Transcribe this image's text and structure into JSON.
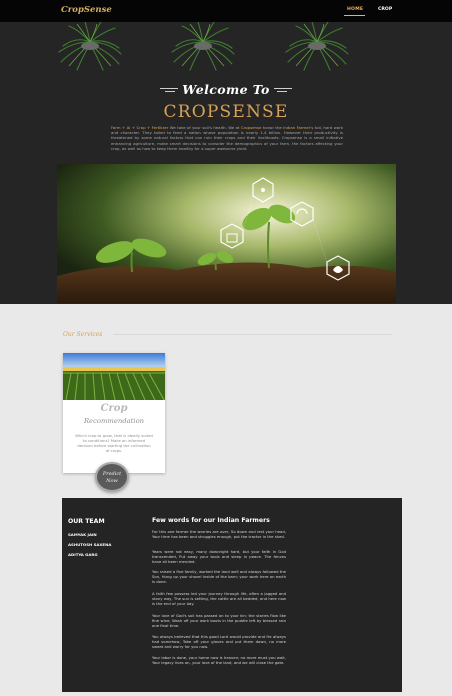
{
  "navbar": {
    "brand": "CropSense",
    "links": [
      {
        "label": "HOME",
        "active": true
      },
      {
        "label": "CROP",
        "active": false
      }
    ]
  },
  "hero": {
    "welcome": "Welcome To",
    "title": "CROPSENSE",
    "intro_highlight_1": "Farm + AI + Crop + Fertilizer",
    "intro_text_1": " We take of your soil's health. We at ",
    "intro_highlight_2": "Cropsense",
    "intro_text_2": " honor the ",
    "intro_highlight_3": "Indian Farmer's",
    "intro_text_3": " toil, hard work and character. They toiled to feed a nation whose population is nearly 1.4 billion. However their productivity is threatened by some natural factors that can ruin their crops and their livelihoods. Cropsense is a small initiative enhancing agriculture, make smart decisions to consider the demographics of your farm, the factors affecting your crop, as well as how to keep them healthy for a ",
    "intro_italic": "super awesome yield",
    "intro_end": ".",
    "image_icons": [
      "plant-network-icon",
      "sprout-icon",
      "recycle-icon",
      "shield-icon",
      "leaf-icon"
    ],
    "colors": {
      "accent": "#d8a257",
      "bg": "#262525"
    }
  },
  "services": {
    "section_title": "Our Services",
    "cards": [
      {
        "title_line1": "Crop",
        "title_line2": "Recommendation",
        "description": "Which crop to grow, that is ideally suited to conditions? Make an informed decision before starting the cultivation of crops.",
        "button_line1": "Predict",
        "button_line2": "Now"
      }
    ]
  },
  "footer": {
    "team_title": "OUR TEAM",
    "team": [
      "SAMYAK JAIN",
      "ASHUTOSH SAXENA",
      "ADITYA GARG"
    ],
    "poem_title": "Few words for our Indian Farmers",
    "poem": [
      "For this one farmer the worries are over, So down and rest your head, Your time has been and struggles enough, put the tractor in the shed.",
      "Years were not easy, many downright hard, but your faith in God transcended, Put away your tools and sleep in peace. The fences have all been mended.",
      "You raised a fine family, worked the land well and always followed the Son, Hung up your shovel inside of the barn; your work here on earth is done.",
      "A faith few possess led your journey through life, often a jagged and stony way, The sun is setting, the cattle are all bedded, and here now is the end of your day.",
      "Your love of God's soil has passed on to your kin; the stories flow like fine wine, Wash off your work boots in the puddle left by blessed rain one final time.",
      "You always believed that this good Lord would provide and He always had somehow, Take off your gloves and put them down, no more sweat and worry for you now.",
      "Your labor is done, your home now is heaven; no more must you wait, Your legacy lives on, your love of the land, and we will close the gate."
    ]
  }
}
